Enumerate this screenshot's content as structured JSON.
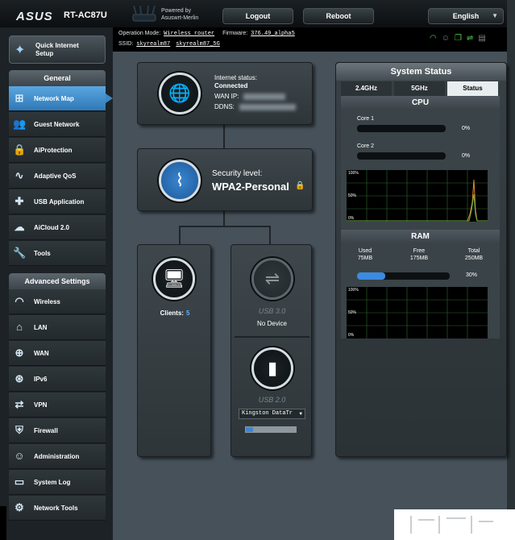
{
  "header": {
    "brand": "ASUS",
    "model": "RT-AC87U",
    "powered_by_line1": "Powered by",
    "powered_by_line2": "Asuswrt-Merlin",
    "logout_label": "Logout",
    "reboot_label": "Reboot",
    "language": "English"
  },
  "modebar": {
    "operation_mode_label": "Operation Mode:",
    "operation_mode_value": "Wireless router",
    "firmware_label": "Firmware:",
    "firmware_value": "376.49_alpha5",
    "ssid_label": "SSID:",
    "ssid_1": "skyrealm87",
    "ssid_2": "skyrealm87_5G",
    "status_icons": [
      "wifi-icon",
      "user-icon",
      "copy-icon",
      "usb-icon",
      "printer-icon"
    ]
  },
  "sidebar": {
    "qis_label_1": "Quick Internet",
    "qis_label_2": "Setup",
    "general_head": "General",
    "general_items": [
      {
        "label": "Network Map",
        "icon": "network-map-icon"
      },
      {
        "label": "Guest Network",
        "icon": "guest-network-icon"
      },
      {
        "label": "AiProtection",
        "icon": "lock-icon"
      },
      {
        "label": "Adaptive QoS",
        "icon": "qos-icon"
      },
      {
        "label": "USB Application",
        "icon": "puzzle-icon"
      },
      {
        "label": "AiCloud 2.0",
        "icon": "cloud-icon"
      },
      {
        "label": "Tools",
        "icon": "wrench-icon"
      }
    ],
    "advanced_head": "Advanced Settings",
    "advanced_items": [
      {
        "label": "Wireless",
        "icon": "wireless-icon"
      },
      {
        "label": "LAN",
        "icon": "home-icon"
      },
      {
        "label": "WAN",
        "icon": "globe-icon"
      },
      {
        "label": "IPv6",
        "icon": "ipv6-icon"
      },
      {
        "label": "VPN",
        "icon": "vpn-icon"
      },
      {
        "label": "Firewall",
        "icon": "shield-icon"
      },
      {
        "label": "Administration",
        "icon": "admin-icon"
      },
      {
        "label": "System Log",
        "icon": "system-log-icon"
      },
      {
        "label": "Network Tools",
        "icon": "network-tools-icon"
      }
    ]
  },
  "internet": {
    "status_label": "Internet status:",
    "status_value": "Connected",
    "wan_ip_label": "WAN IP:",
    "ddns_label": "DDNS:"
  },
  "security": {
    "label": "Security level:",
    "value": "WPA2-Personal"
  },
  "clients": {
    "label": "Clients:",
    "count": "5"
  },
  "usb": {
    "usb3_label": "USB 3.0",
    "usb3_device": "No Device",
    "usb2_label": "USB 2.0",
    "usb2_device": "Kingston DataTr",
    "usb2_usage_fraction": 0.15
  },
  "system_status": {
    "title": "System Status",
    "tabs": [
      "2.4GHz",
      "5GHz",
      "Status"
    ],
    "active_tab": 2,
    "cpu_head": "CPU",
    "cores": [
      {
        "label": "Core 1",
        "percent": "0%",
        "fraction": 0
      },
      {
        "label": "Core 2",
        "percent": "0%",
        "fraction": 0
      }
    ],
    "graph_ticks": [
      "100%",
      "50%",
      "0%"
    ],
    "ram_head": "RAM",
    "ram": {
      "used_label": "Used",
      "used_value": "75MB",
      "free_label": "Free",
      "free_value": "175MB",
      "total_label": "Total",
      "total_value": "250MB",
      "percent": "30%",
      "fraction": 0.3
    }
  },
  "colors": {
    "accent_blue": "#3b8be0",
    "active_nav": "#3a87c4",
    "cpu_line_orange": "#e38b2b",
    "cpu_line_green": "#6fb04a"
  }
}
